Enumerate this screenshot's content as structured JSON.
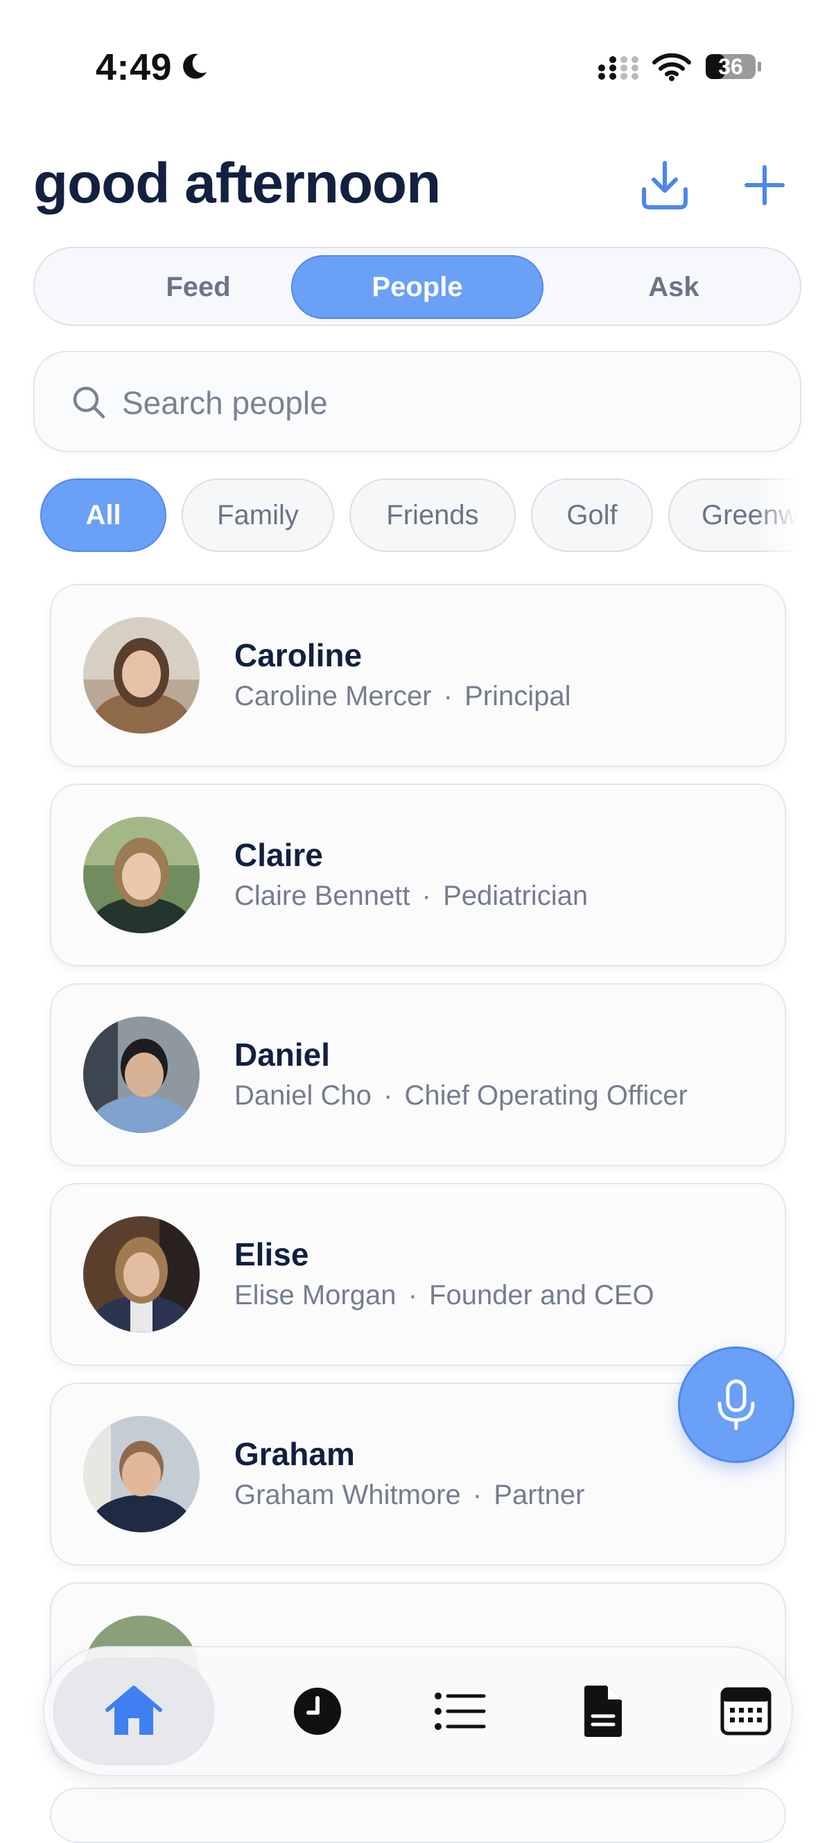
{
  "status_bar": {
    "time": "4:49",
    "battery": "36"
  },
  "header": {
    "greeting": "good afternoon"
  },
  "segments": {
    "feed": "Feed",
    "people": "People",
    "ask": "Ask",
    "selected": "People"
  },
  "search": {
    "placeholder": "Search people",
    "value": ""
  },
  "filters": {
    "selected": "All",
    "chips": [
      "All",
      "Family",
      "Friends",
      "Golf",
      "Greenw"
    ]
  },
  "people": [
    {
      "name": "Caroline",
      "full_name": "Caroline Mercer",
      "sep": "·",
      "title": "Principal"
    },
    {
      "name": "Claire",
      "full_name": "Claire Bennett",
      "sep": "·",
      "title": "Pediatrician"
    },
    {
      "name": "Daniel",
      "full_name": "Daniel Cho",
      "sep": "·",
      "title": "Chief Operating Officer"
    },
    {
      "name": "Elise",
      "full_name": "Elise Morgan",
      "sep": "·",
      "title": "Founder and CEO"
    },
    {
      "name": "Graham",
      "full_name": "Graham Whitmore",
      "sep": "·",
      "title": "Partner"
    }
  ],
  "tabbar": {
    "icons": [
      "home-icon",
      "clock-icon",
      "list-icon",
      "document-icon",
      "calendar-icon"
    ],
    "selected": "home-icon"
  },
  "colors": {
    "accent": "#6aa0f6",
    "accent_border": "#4f89ee",
    "heading": "#13203f",
    "muted": "#747d8f"
  }
}
